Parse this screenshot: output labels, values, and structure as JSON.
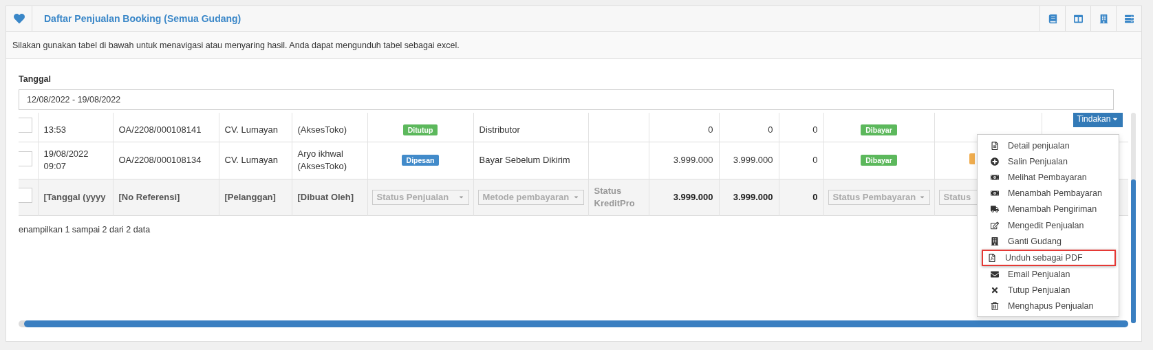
{
  "header": {
    "title": "Daftar Penjualan Booking (Semua Gudang)",
    "tools": [
      {
        "kind": "book"
      },
      {
        "kind": "columns"
      },
      {
        "kind": "building"
      },
      {
        "kind": "list"
      }
    ]
  },
  "description": "Silakan gunakan tabel di bawah untuk menavigasi atau menyaring hasil. Anda dapat mengunduh tabel sebagai excel.",
  "date_filter": {
    "label": "Tanggal",
    "value": "12/08/2022 - 19/08/2022"
  },
  "table": {
    "rows": [
      {
        "checked": false,
        "cells": [
          {
            "kind": "text",
            "text": "13:53"
          },
          {
            "kind": "text",
            "text": "OA/2208/000108141"
          },
          {
            "kind": "text",
            "text": "CV. Lumayan"
          },
          {
            "kind": "text",
            "text": "(AksesToko)"
          },
          {
            "kind": "badge",
            "text": "Ditutup",
            "color": "#5cb85c"
          },
          {
            "kind": "text",
            "text": "Distributor"
          },
          {
            "kind": "empty"
          },
          {
            "kind": "number",
            "text": "0"
          },
          {
            "kind": "number",
            "text": "0"
          },
          {
            "kind": "number",
            "text": "0"
          },
          {
            "kind": "badge",
            "text": "Dibayar",
            "color": "#5cb85c"
          },
          {
            "kind": "empty"
          },
          {
            "kind": "button",
            "text": "Tindakan"
          }
        ]
      },
      {
        "checked": false,
        "cells": [
          {
            "kind": "text",
            "text": "19/08/2022 09:07"
          },
          {
            "kind": "text",
            "text": "OA/2208/000108134"
          },
          {
            "kind": "text",
            "text": "CV. Lumayan"
          },
          {
            "kind": "text",
            "text": "Aryo ikhwal (AksesToko)"
          },
          {
            "kind": "badge",
            "text": "Dipesan",
            "color": "#428bca"
          },
          {
            "kind": "text",
            "text": "Bayar Sebelum Dikirim"
          },
          {
            "kind": "empty"
          },
          {
            "kind": "number",
            "text": "3.999.000"
          },
          {
            "kind": "number",
            "text": "3.999.000"
          },
          {
            "kind": "number",
            "text": "0"
          },
          {
            "kind": "badge",
            "text": "Dibayar",
            "color": "#5cb85c"
          },
          {
            "kind": "badge-stub",
            "color": "#f0ad4e"
          },
          {
            "kind": "empty"
          }
        ]
      }
    ],
    "filter_row": {
      "checked": false,
      "cells": [
        {
          "kind": "label",
          "text": "[Tanggal (yyyy"
        },
        {
          "kind": "label",
          "text": "[No Referensi]"
        },
        {
          "kind": "label",
          "text": "[Pelanggan]"
        },
        {
          "kind": "label",
          "text": "[Dibuat Oleh]"
        },
        {
          "kind": "select",
          "placeholder": "Status Penjualan"
        },
        {
          "kind": "select",
          "placeholder": "Metode pembayaran"
        },
        {
          "kind": "muted",
          "text": "Status KreditPro"
        },
        {
          "kind": "total",
          "text": "3.999.000"
        },
        {
          "kind": "total",
          "text": "3.999.000"
        },
        {
          "kind": "total",
          "text": "0"
        },
        {
          "kind": "select",
          "placeholder": "Status Pembayaran"
        },
        {
          "kind": "select-cut",
          "placeholder": "Status"
        },
        {
          "kind": "empty"
        }
      ]
    }
  },
  "info": "enampilkan 1 sampai 2 dari 2 data",
  "action_menu": [
    {
      "kind": "detail",
      "label": "Detail penjualan",
      "highlighted": false
    },
    {
      "kind": "copy",
      "label": "Salin Penjualan",
      "highlighted": false
    },
    {
      "kind": "money",
      "label": "Melihat Pembayaran",
      "highlighted": false
    },
    {
      "kind": "money",
      "label": "Menambah Pembayaran",
      "highlighted": false
    },
    {
      "kind": "truck",
      "label": "Menambah Pengiriman",
      "highlighted": false
    },
    {
      "kind": "edit",
      "label": "Mengedit Penjualan",
      "highlighted": false
    },
    {
      "kind": "building",
      "label": "Ganti Gudang",
      "highlighted": false
    },
    {
      "kind": "pdf",
      "label": "Unduh sebagai PDF",
      "highlighted": true
    },
    {
      "kind": "email",
      "label": "Email Penjualan",
      "highlighted": false
    },
    {
      "kind": "close",
      "label": "Tutup Penjualan",
      "highlighted": false
    },
    {
      "kind": "trash",
      "label": "Menghapus Penjualan",
      "highlighted": false
    }
  ]
}
